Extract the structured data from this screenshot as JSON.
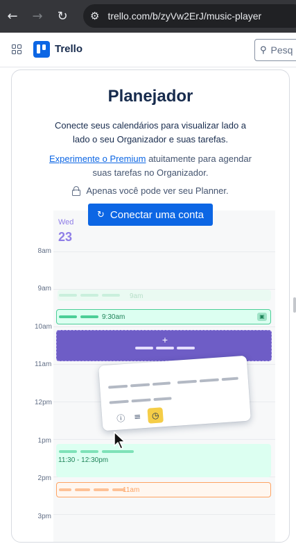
{
  "browser": {
    "back_icon": "arrow-left-icon",
    "forward_icon": "arrow-right-icon",
    "reload_icon": "reload-icon",
    "url": "trello.com/b/zyVw2ErJ/music-player"
  },
  "header": {
    "brand": "Trello",
    "search_placeholder": "Pesq"
  },
  "planner": {
    "title": "Planejador",
    "description": "Conecte seus calendários para visualizar lado a lado o seu Organizador e suas tarefas.",
    "premium_link": "Experimente o Premium",
    "premium_rest": " atuitamente para agendar suas tarefas no Organizador.",
    "privacy": "Apenas você pode ver seu Planner.",
    "connect_button": "Conectar uma conta"
  },
  "calendar": {
    "day_label": "Wed",
    "day_number": "23",
    "hours": [
      "8am",
      "9am",
      "10am",
      "11am",
      "12pm",
      "1pm",
      "2pm",
      "3pm"
    ],
    "events": {
      "ghost": "9am",
      "green": "9:30am",
      "add": "+",
      "long": "11:30 - 12:30pm",
      "orange": "11am"
    }
  },
  "colors": {
    "accent": "#0c66e4",
    "purple_event": "#6e5dc6",
    "green_event": "#dcfff1",
    "orange_border": "#fea362",
    "clock_highlight": "#f5cd47"
  }
}
